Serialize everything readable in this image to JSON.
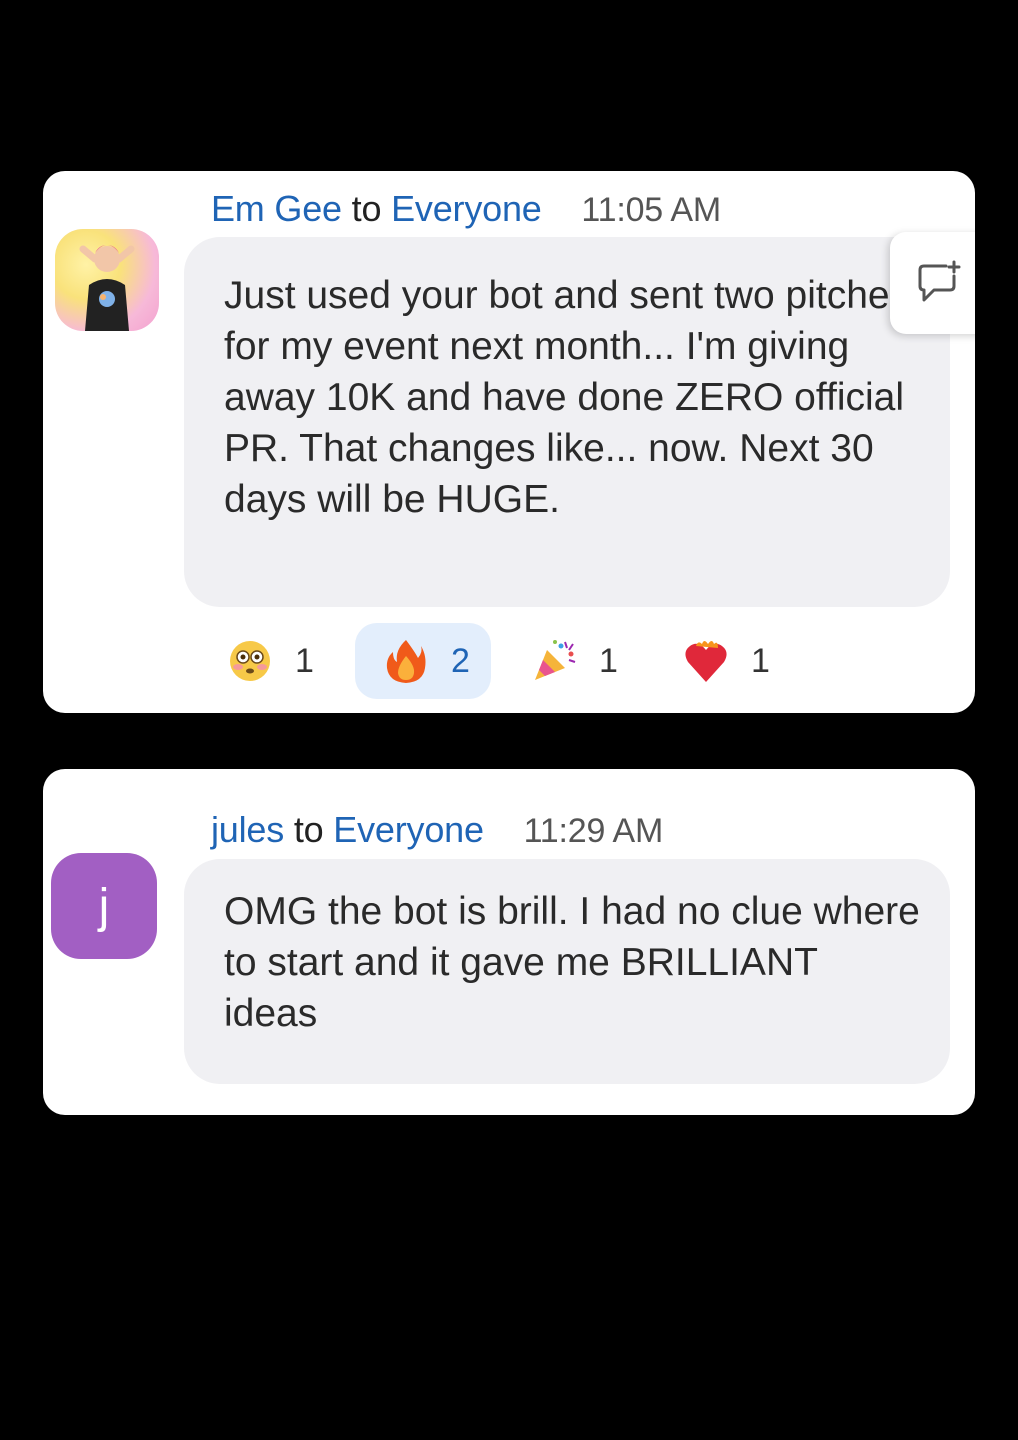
{
  "messages": [
    {
      "sender": "Em Gee",
      "to_word": "to",
      "recipient": "Everyone",
      "time": "11:05 AM",
      "text": "Just used your bot and sent two pitches for my event next month... I'm giving away 10K and have done ZERO official PR. That changes like... now. Next 30 days will be HUGE.",
      "reactions": [
        {
          "emoji": "flushed-face",
          "count": "1",
          "active": false
        },
        {
          "emoji": "fire",
          "count": "2",
          "active": true
        },
        {
          "emoji": "party-popper",
          "count": "1",
          "active": false
        },
        {
          "emoji": "heart-on-fire",
          "count": "1",
          "active": false
        }
      ]
    },
    {
      "sender": "jules",
      "to_word": "to",
      "recipient": "Everyone",
      "time": "11:29 AM",
      "avatar_letter": "j",
      "text": "OMG the bot is brill. I had no clue where to start and it gave me BRILLIANT ideas"
    }
  ],
  "colors": {
    "link": "#1f64b5",
    "bubble": "#f0f0f3",
    "avatar_purple": "#a25fc3",
    "active_reaction": "#e3eefc"
  }
}
